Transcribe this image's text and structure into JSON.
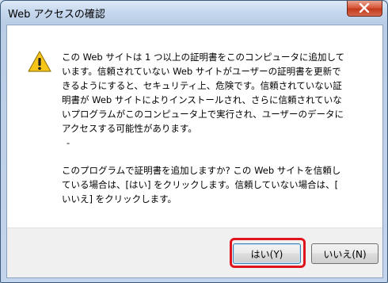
{
  "window": {
    "title": "Web アクセスの確認"
  },
  "message": {
    "lines": [
      "この Web サイトは 1 つ以上の証明書をこのコンピュータに追加して",
      "います。信頼されていない Web サイトがユーザーの証明書を更新で",
      "きるようにすると、セキュリティ上、危険です。信頼されていない証",
      "明書が Web サイトによりインストールされ、さらに信頼されていな",
      "いプログラムがこのコンピュータ上で実行され、ユーザーのデータに",
      "アクセスする可能性があります。"
    ],
    "dash": "-",
    "question_lines": [
      "このプログラムで証明書を追加しますか? この Web サイトを信頼し",
      "ている場合は、[はい] をクリックします。信頼していない場合は、[",
      "いいえ] をクリックします。"
    ]
  },
  "buttons": {
    "yes_label": "はい(Y)",
    "no_label": "いいえ(N)"
  },
  "icons": {
    "warning": "warning-icon",
    "close": "close-icon"
  },
  "colors": {
    "highlight": "#e0141c",
    "warning_fill": "#f5c518"
  }
}
